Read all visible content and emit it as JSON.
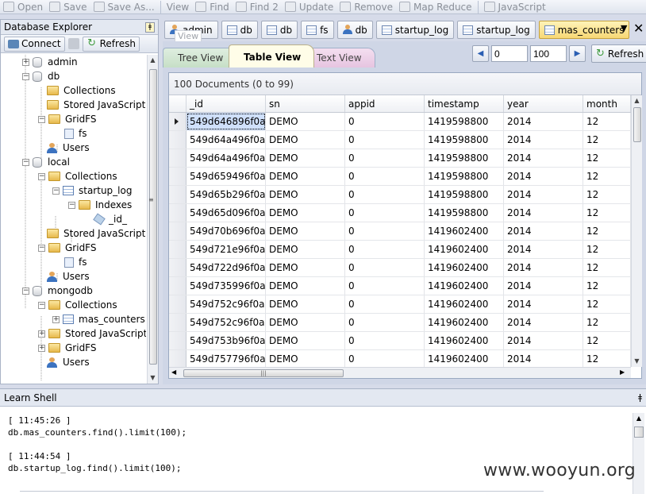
{
  "toolbar": {
    "items": [
      {
        "label": "Open",
        "icon": "open-icon"
      },
      {
        "label": "Save",
        "icon": "save-icon"
      },
      {
        "label": "Save As...",
        "icon": "save-as-icon"
      },
      {
        "label": "View",
        "icon": ""
      },
      {
        "label": "Find",
        "icon": "find-icon"
      },
      {
        "label": "Find 2",
        "icon": "find-icon"
      },
      {
        "label": "Update",
        "icon": "update-icon"
      },
      {
        "label": "Remove",
        "icon": "remove-icon"
      },
      {
        "label": "Map Reduce",
        "icon": "map-reduce-icon"
      },
      {
        "label": "JavaScript",
        "icon": "javascript-icon"
      }
    ]
  },
  "explorer": {
    "title": "Database Explorer",
    "pin": "ǂ",
    "connect_label": "Connect",
    "refresh_label": "Refresh",
    "tree": [
      {
        "label": "admin",
        "type": "db"
      },
      {
        "label": "db",
        "type": "db"
      },
      {
        "label": "Collections",
        "type": "folder"
      },
      {
        "label": "Stored JavaScript",
        "type": "folder"
      },
      {
        "label": "GridFS",
        "type": "folder"
      },
      {
        "label": "fs",
        "type": "file"
      },
      {
        "label": "Users",
        "type": "user"
      },
      {
        "label": "local",
        "type": "db"
      },
      {
        "label": "Collections",
        "type": "folder"
      },
      {
        "label": "startup_log",
        "type": "table"
      },
      {
        "label": "Indexes",
        "type": "folder"
      },
      {
        "label": "_id_",
        "type": "tag"
      },
      {
        "label": "Stored JavaScript",
        "type": "folder"
      },
      {
        "label": "GridFS",
        "type": "folder"
      },
      {
        "label": "fs",
        "type": "file"
      },
      {
        "label": "Users",
        "type": "user"
      },
      {
        "label": "mongodb",
        "type": "db"
      },
      {
        "label": "Collections",
        "type": "folder"
      },
      {
        "label": "mas_counters",
        "type": "table"
      },
      {
        "label": "Stored JavaScript",
        "type": "folder"
      },
      {
        "label": "GridFS",
        "type": "folder"
      },
      {
        "label": "Users",
        "type": "user"
      }
    ]
  },
  "doc_tabs": {
    "tabs": [
      {
        "label": "admin",
        "icon": "user-icon"
      },
      {
        "label": "db",
        "icon": "table-icon"
      },
      {
        "label": "db",
        "icon": "table-icon"
      },
      {
        "label": "fs",
        "icon": "file-icon"
      },
      {
        "label": "db",
        "icon": "user-icon"
      },
      {
        "label": "startup_log",
        "icon": "table-icon"
      },
      {
        "label": "startup_log",
        "icon": "table-icon"
      },
      {
        "label": "mas_counters",
        "icon": "table-icon",
        "active": true
      }
    ],
    "ghost_label": "View",
    "menu_glyph": "▼",
    "close_glyph": "✕"
  },
  "view_tabs": {
    "tree": "Tree View",
    "table": "Table View",
    "text": "Text View"
  },
  "pager": {
    "from": "0",
    "count": "100",
    "refresh_label": "Refresh",
    "prev_glyph": "◀",
    "next_glyph": "▶"
  },
  "grid": {
    "title": "100 Documents (0 to 99)",
    "columns": [
      "_id",
      "sn",
      "appid",
      "timestamp",
      "year",
      "month"
    ],
    "rows": [
      [
        "549d646896f0a...",
        "DEMO",
        "0",
        "1419598800",
        "2014",
        "12"
      ],
      [
        "549d64a496f0a...",
        "DEMO",
        "0",
        "1419598800",
        "2014",
        "12"
      ],
      [
        "549d64a496f0a...",
        "DEMO",
        "0",
        "1419598800",
        "2014",
        "12"
      ],
      [
        "549d659496f0a...",
        "DEMO",
        "0",
        "1419598800",
        "2014",
        "12"
      ],
      [
        "549d65b296f0a...",
        "DEMO",
        "0",
        "1419598800",
        "2014",
        "12"
      ],
      [
        "549d65d096f0a...",
        "DEMO",
        "0",
        "1419598800",
        "2014",
        "12"
      ],
      [
        "549d70b696f0a...",
        "DEMO",
        "0",
        "1419602400",
        "2014",
        "12"
      ],
      [
        "549d721e96f0a...",
        "DEMO",
        "0",
        "1419602400",
        "2014",
        "12"
      ],
      [
        "549d722d96f0a...",
        "DEMO",
        "0",
        "1419602400",
        "2014",
        "12"
      ],
      [
        "549d735996f0a...",
        "DEMO",
        "0",
        "1419602400",
        "2014",
        "12"
      ],
      [
        "549d752c96f0a...",
        "DEMO",
        "0",
        "1419602400",
        "2014",
        "12"
      ],
      [
        "549d752c96f0a...",
        "DEMO",
        "0",
        "1419602400",
        "2014",
        "12"
      ],
      [
        "549d753b96f0a...",
        "DEMO",
        "0",
        "1419602400",
        "2014",
        "12"
      ],
      [
        "549d757796f0a...",
        "DEMO",
        "0",
        "1419602400",
        "2014",
        "12"
      ]
    ]
  },
  "shell": {
    "title": "Learn Shell",
    "pin": "ǂ",
    "lines": [
      "[ 11:45:26 ]",
      "db.mas_counters.find().limit(100);",
      "",
      "[ 11:44:54 ]",
      "db.startup_log.find().limit(100);"
    ]
  },
  "watermark": "www.wooyun.org"
}
